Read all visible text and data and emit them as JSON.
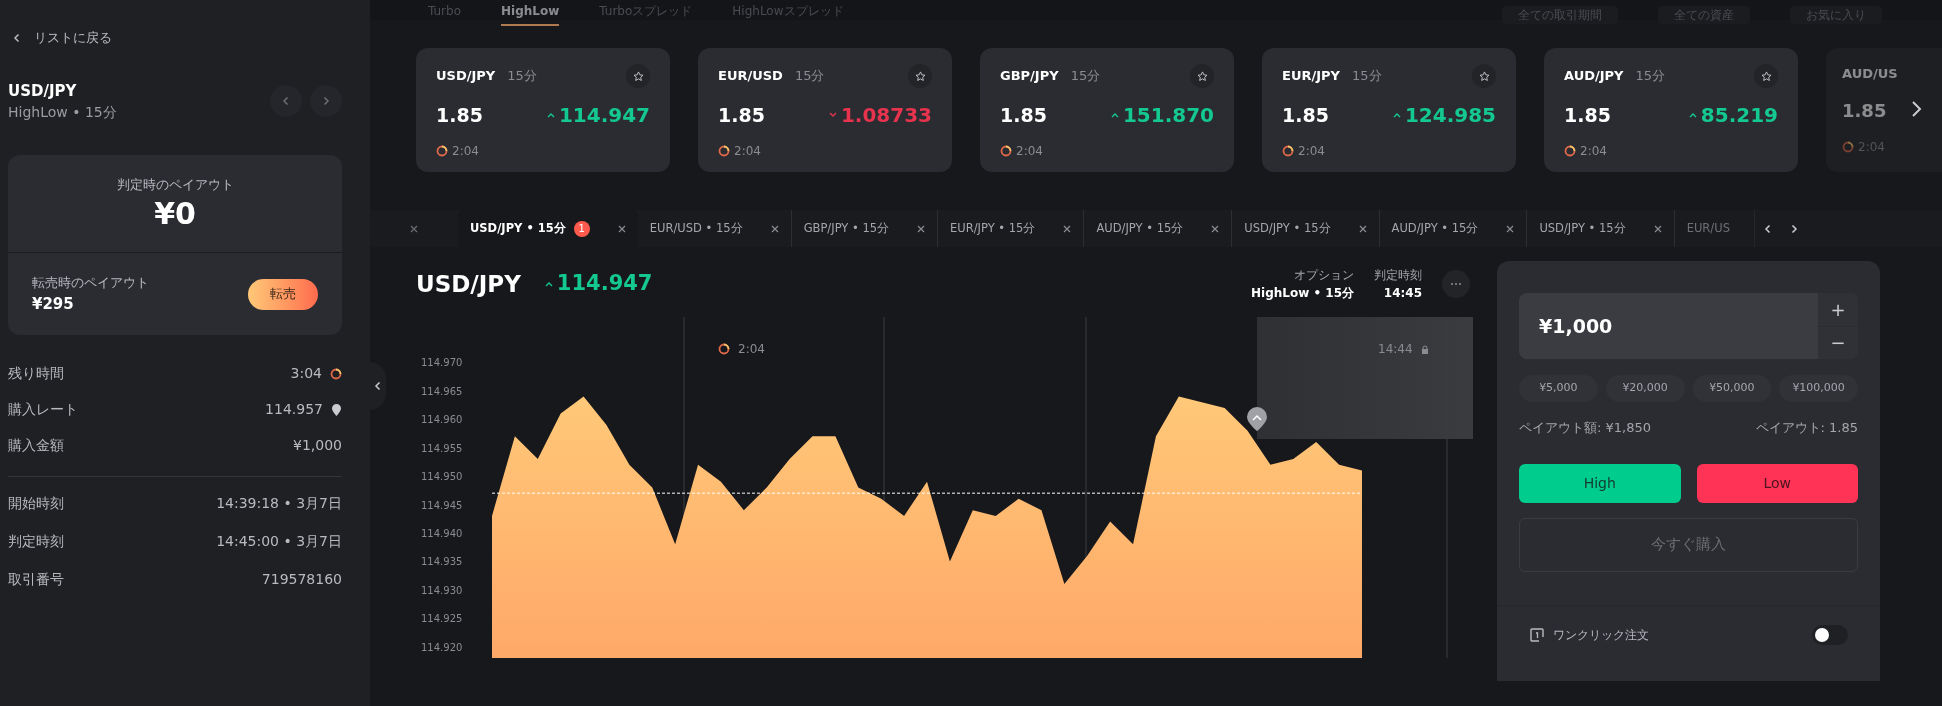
{
  "sidebar": {
    "back": "リストに戻る",
    "pair": "USD/JPY",
    "subtitle": "HighLow • 15分",
    "payout_card": {
      "title": "判定時のペイアウト",
      "amount": "¥0",
      "resale_label": "転売時のペイアウト",
      "resale_amount": "¥295",
      "resale_button": "転売"
    },
    "details": [
      {
        "label": "残り時間",
        "value": "3:04",
        "kind": "timer"
      },
      {
        "label": "購入レート",
        "value": "114.957",
        "kind": "pin"
      },
      {
        "label": "購入金額",
        "value": "¥1,000",
        "kind": "plain"
      }
    ],
    "times": [
      {
        "label": "開始時刻",
        "value": "14:39:18 • 3月7日"
      },
      {
        "label": "判定時刻",
        "value": "14:45:00 • 3月7日"
      },
      {
        "label": "取引番号",
        "value": "719578160"
      }
    ]
  },
  "top_tabs": [
    {
      "label": "Turbo",
      "selected": false
    },
    {
      "label": "HighLow",
      "selected": true
    },
    {
      "label": "Turboスプレッド",
      "selected": false
    },
    {
      "label": "HighLowスプレッド",
      "selected": false
    }
  ],
  "filters": [
    "全ての取引期間",
    "全ての資産",
    "お気に入り"
  ],
  "assets": [
    {
      "pair": "USD/JPY",
      "period": "15分",
      "payout": "1.85",
      "rate": "114.947",
      "rising": true,
      "time": "2:04",
      "kind": "full"
    },
    {
      "pair": "EUR/USD",
      "period": "15分",
      "payout": "1.85",
      "rate": "1.08733",
      "rising": false,
      "time": "2:04",
      "kind": "full"
    },
    {
      "pair": "GBP/JPY",
      "period": "15分",
      "payout": "1.85",
      "rate": "151.870",
      "rising": true,
      "time": "2:04",
      "kind": "full"
    },
    {
      "pair": "EUR/JPY",
      "period": "15分",
      "payout": "1.85",
      "rate": "124.985",
      "rising": true,
      "time": "2:04",
      "kind": "full"
    },
    {
      "pair": "AUD/JPY",
      "period": "15分",
      "payout": "1.85",
      "rate": "85.219",
      "rising": true,
      "time": "2:04",
      "kind": "full"
    },
    {
      "pair": "AUD/US",
      "payout": "1.85",
      "time": "2:04",
      "kind": "partial"
    }
  ],
  "trade_tabs": [
    {
      "label": "USD/JPY • 15分",
      "badge": "1",
      "selected": true
    },
    {
      "label": "EUR/USD • 15分",
      "selected": false
    },
    {
      "label": "GBP/JPY • 15分",
      "selected": false
    },
    {
      "label": "EUR/JPY • 15分",
      "selected": false
    },
    {
      "label": "AUD/JPY • 15分",
      "selected": false
    },
    {
      "label": "USD/JPY • 15分",
      "selected": false
    },
    {
      "label": "AUD/JPY • 15分",
      "selected": false
    },
    {
      "label": "USD/JPY • 15分",
      "selected": false
    },
    {
      "label": "EUR/US",
      "selected": false,
      "kind": "partial"
    }
  ],
  "chart": {
    "pair": "USD/JPY",
    "rate": "114.947",
    "rising": true,
    "option_label": "オプション",
    "option_value": "HighLow • 15分",
    "expiry_label": "判定時刻",
    "expiry_value": "14:45",
    "timer": "2:04",
    "lock_time": "14:44",
    "chart_data": {
      "type": "area",
      "ylim": [
        114.918,
        114.978
      ],
      "yticks": [
        {
          "value": 114.97,
          "label": "114.970"
        },
        {
          "value": 114.965,
          "label": "114.965"
        },
        {
          "value": 114.96,
          "label": "114.960"
        },
        {
          "value": 114.955,
          "label": "114.955"
        },
        {
          "value": 114.95,
          "label": "114.950"
        },
        {
          "value": 114.945,
          "label": "114.945"
        },
        {
          "value": 114.94,
          "label": "114.940"
        },
        {
          "value": 114.935,
          "label": "114.935"
        },
        {
          "value": 114.93,
          "label": "114.930"
        },
        {
          "value": 114.925,
          "label": "114.925"
        },
        {
          "value": 114.92,
          "label": "114.920"
        }
      ],
      "series": [
        {
          "color": "#ffc878",
          "values": [
            114.943,
            114.957,
            114.953,
            114.961,
            114.964,
            114.959,
            114.952,
            114.948,
            114.938,
            114.952,
            114.949,
            114.944,
            114.948,
            114.953,
            114.957,
            114.957,
            114.948,
            114.946,
            114.943,
            114.949,
            114.935,
            114.944,
            114.943,
            114.946,
            114.944,
            114.931,
            114.936,
            114.942,
            114.938,
            114.957,
            114.964,
            114.963,
            114.962,
            114.958,
            114.952,
            114.953,
            114.956,
            114.952,
            114.951
          ]
        },
        {
          "color": "#ffffff",
          "type": "line",
          "line_style": "dashed",
          "values": [
            114.947,
            114.947,
            114.947,
            114.947,
            114.947,
            114.947,
            114.947,
            114.947,
            114.947,
            114.947,
            114.947,
            114.947,
            114.947,
            114.947,
            114.947,
            114.947,
            114.947,
            114.947,
            114.947,
            114.947,
            114.947,
            114.947,
            114.947,
            114.947,
            114.947,
            114.947,
            114.947,
            114.947,
            114.947,
            114.947,
            114.947,
            114.947,
            114.947,
            114.947,
            114.947,
            114.947,
            114.947,
            114.947,
            114.947
          ]
        }
      ]
    }
  },
  "order": {
    "amount": "¥1,000",
    "plus": "+",
    "minus": "−",
    "presets": [
      "¥5,000",
      "¥20,000",
      "¥50,000",
      "¥100,000"
    ],
    "payout_amount": "ペイアウト額: ¥1,850",
    "payout_rate": "ペイアウト: 1.85",
    "high": "High",
    "low": "Low",
    "buy_now": "今すぐ購入",
    "one_click": "ワンクリック注文",
    "one_click_on": false
  }
}
